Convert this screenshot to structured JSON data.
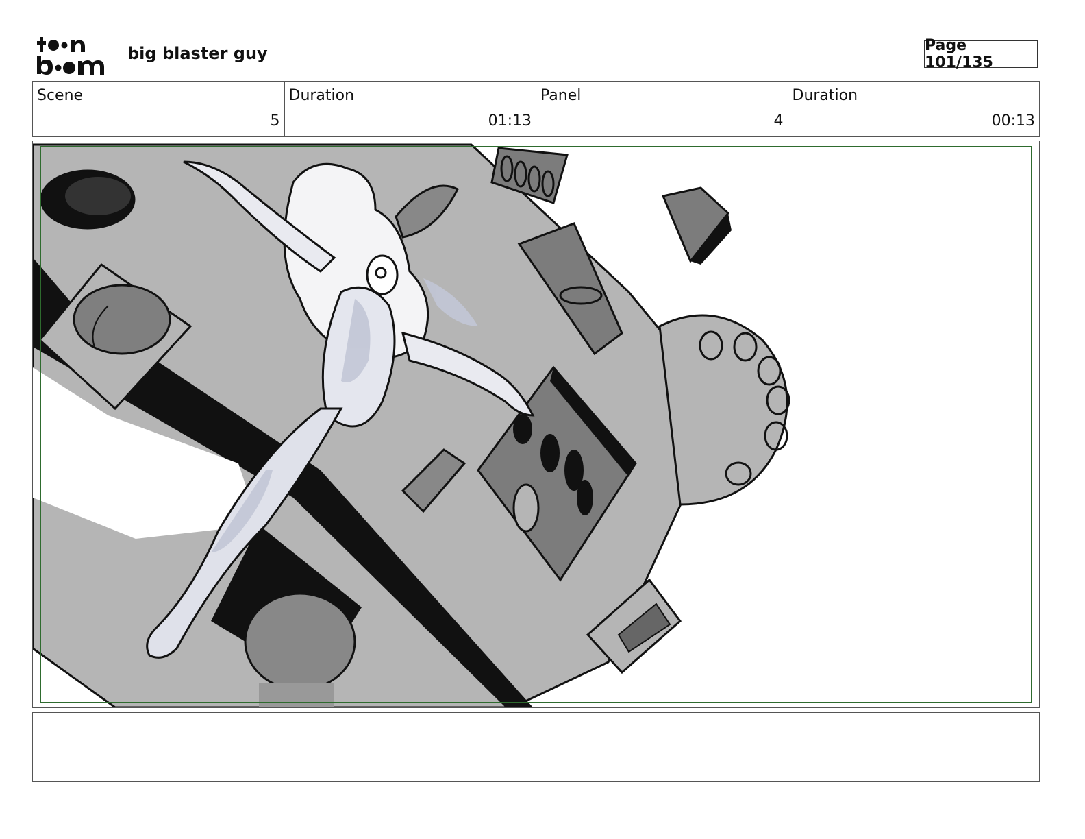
{
  "header": {
    "logo": "toon boom",
    "logo_line1": "toon",
    "logo_line2": "boom",
    "project_title": "big blaster guy",
    "page_label": "Page 101/135"
  },
  "info": {
    "scene_label": "Scene",
    "scene_value": "5",
    "scene_duration_label": "Duration",
    "scene_duration_value": "01:13",
    "panel_label": "Panel",
    "panel_value": "4",
    "panel_duration_label": "Duration",
    "panel_duration_value": "00:13"
  },
  "panel": {
    "image_icon": "storyboard-sketch-image",
    "safe_frame_color": "#2e6b2e"
  },
  "notes": {
    "text": ""
  }
}
